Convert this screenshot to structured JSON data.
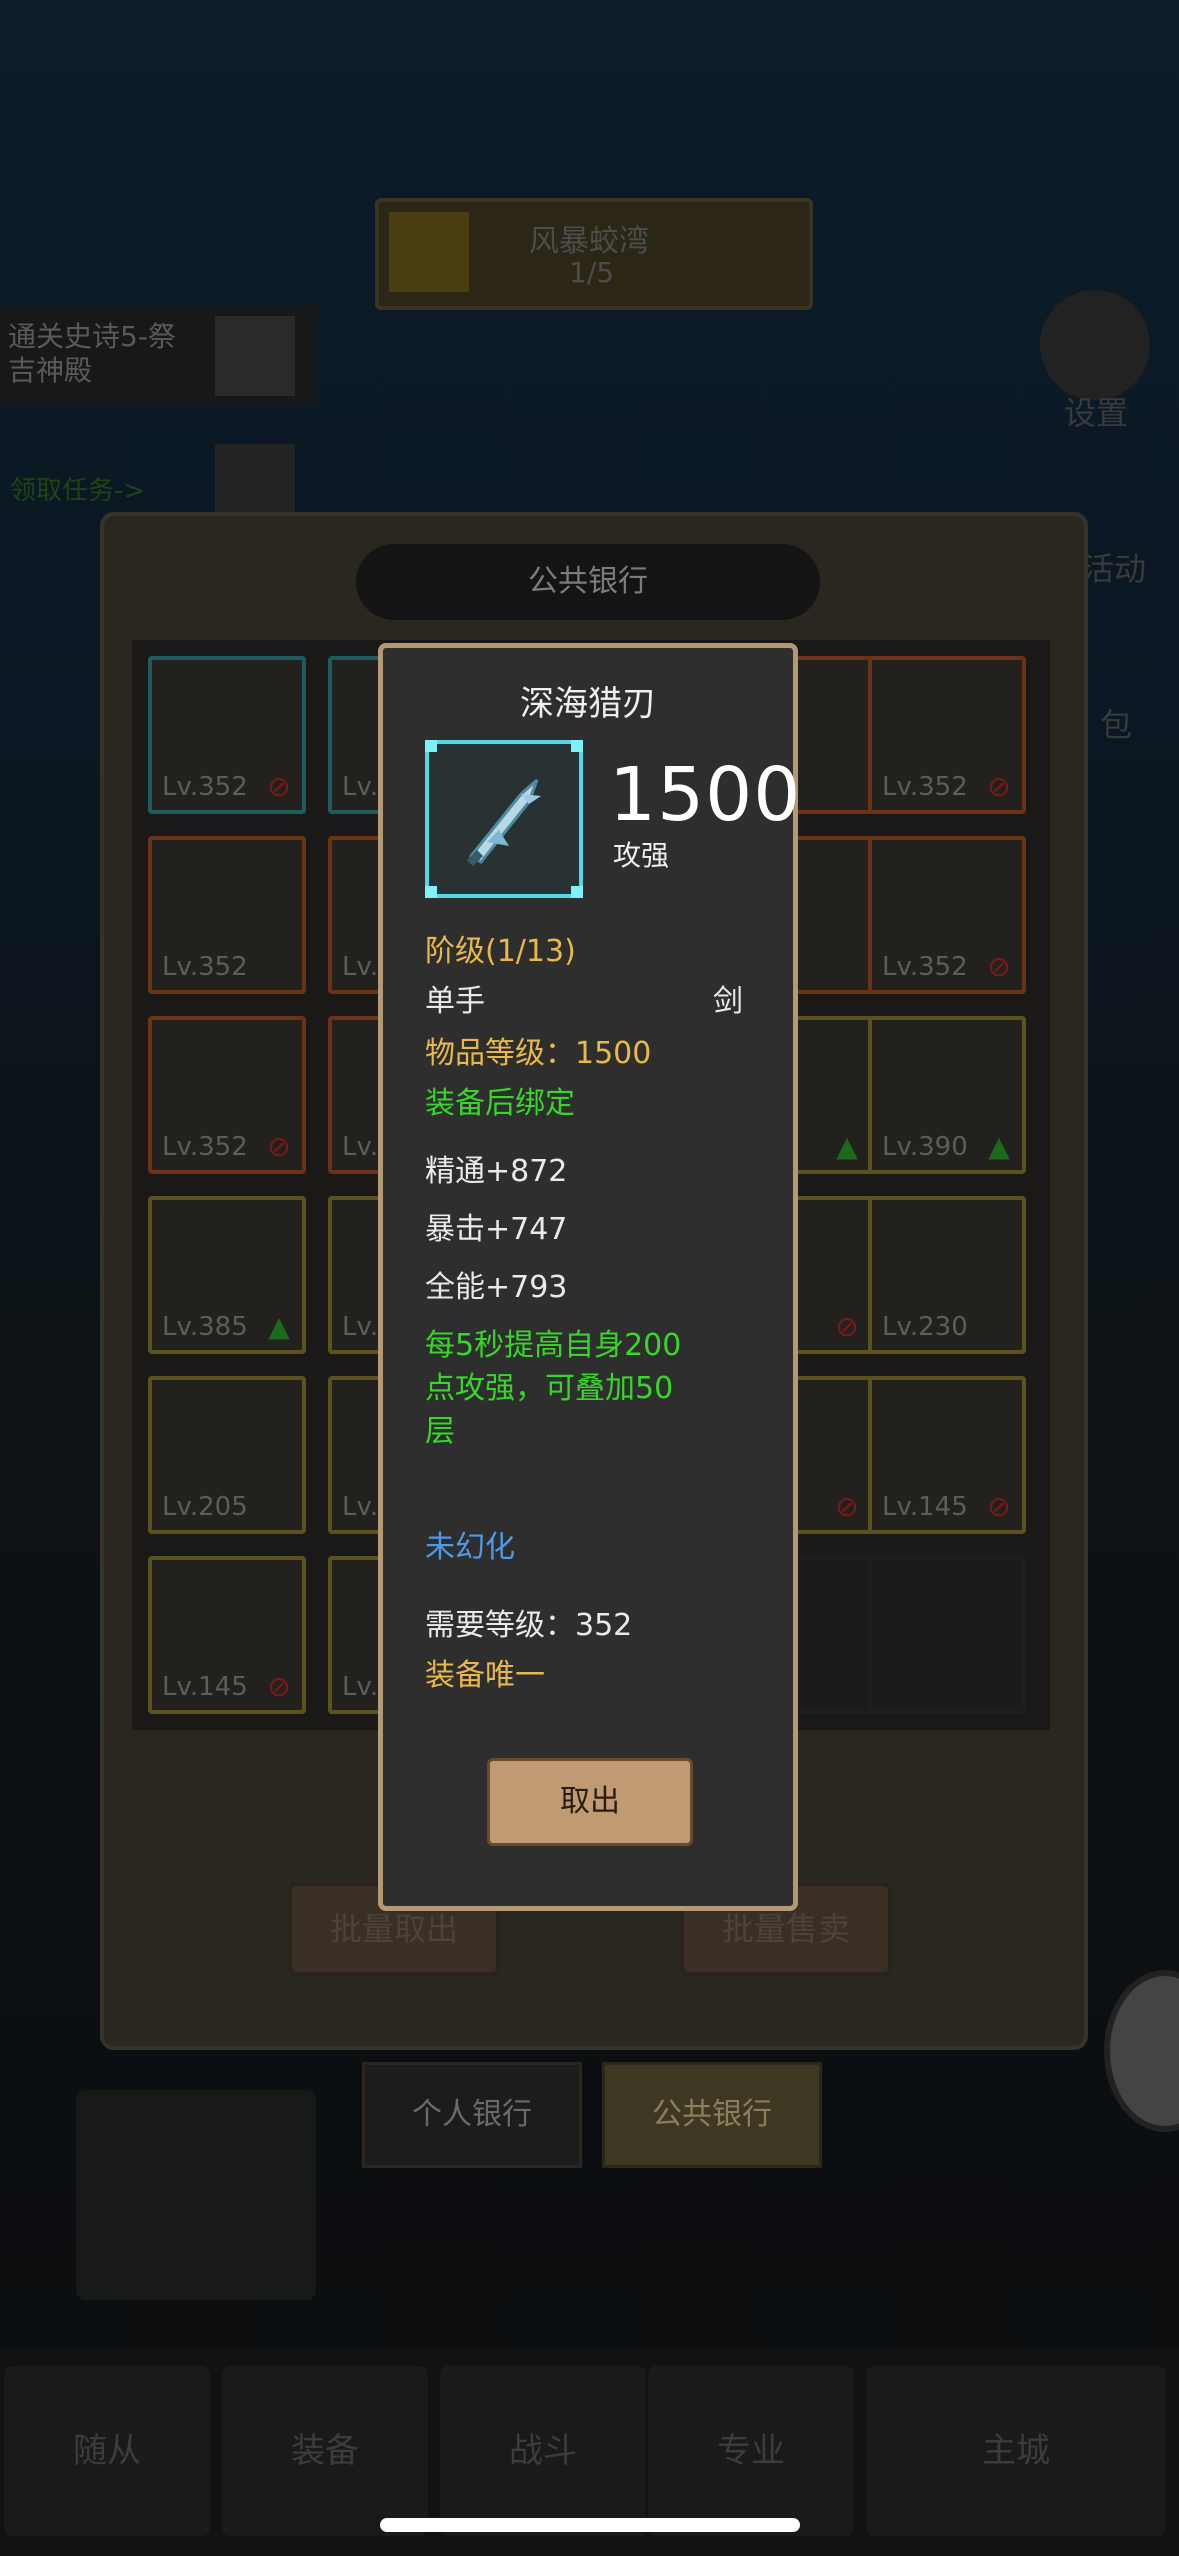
{
  "top_event": {
    "title": "风暴蛟湾",
    "progress": "1/5"
  },
  "quest": {
    "text": "通关史诗5-祭\n吉神殿",
    "task": "领取任务->"
  },
  "side_labels": {
    "settings": "设置",
    "activity": "活动",
    "bag": "包"
  },
  "bank": {
    "title": "公共银行",
    "slots": [
      {
        "lv": "Lv.352",
        "quality": "cyan",
        "mark": "ban"
      },
      {
        "lv": "Lv.",
        "quality": "cyan",
        "mark": ""
      },
      {
        "lv": "",
        "quality": "orange",
        "mark": ""
      },
      {
        "lv": "Lv.352",
        "quality": "orange",
        "mark": "ban"
      },
      {
        "lv": "Lv.352",
        "quality": "orange",
        "mark": ""
      },
      {
        "lv": "Lv.",
        "quality": "orange",
        "mark": ""
      },
      {
        "lv": "",
        "quality": "orange",
        "mark": ""
      },
      {
        "lv": "Lv.352",
        "quality": "orange",
        "mark": "ban"
      },
      {
        "lv": "Lv.352",
        "quality": "orange",
        "mark": "ban"
      },
      {
        "lv": "Lv.",
        "quality": "orange",
        "mark": ""
      },
      {
        "lv": "",
        "quality": "yellow",
        "mark": "up"
      },
      {
        "lv": "Lv.390",
        "quality": "yellow",
        "mark": "up"
      },
      {
        "lv": "Lv.385",
        "quality": "yellow",
        "mark": "up"
      },
      {
        "lv": "Lv.",
        "quality": "yellow",
        "mark": ""
      },
      {
        "lv": "",
        "quality": "yellow",
        "mark": "ban"
      },
      {
        "lv": "Lv.230",
        "quality": "yellow",
        "mark": ""
      },
      {
        "lv": "Lv.205",
        "quality": "yellow",
        "mark": ""
      },
      {
        "lv": "Lv.",
        "quality": "yellow",
        "mark": ""
      },
      {
        "lv": "",
        "quality": "yellow",
        "mark": "ban"
      },
      {
        "lv": "Lv.145",
        "quality": "yellow",
        "mark": "ban"
      },
      {
        "lv": "Lv.145",
        "quality": "yellow",
        "mark": "ban"
      },
      {
        "lv": "Lv.",
        "quality": "yellow",
        "mark": ""
      },
      {
        "lv": "",
        "quality": "empty",
        "mark": ""
      },
      {
        "lv": "",
        "quality": "empty",
        "mark": ""
      }
    ],
    "batch_take": "批量取出",
    "batch_sell": "批量售卖",
    "tabs": {
      "personal": "个人银行",
      "public": "公共银行"
    }
  },
  "bottom_nav": [
    "随从",
    "装备",
    "战斗",
    "专业",
    "主城"
  ],
  "item": {
    "name": "深海猎刃",
    "power": "1500",
    "power_label": "攻强",
    "tier": "阶级(1/13)",
    "hand": "单手",
    "type": "剑",
    "item_level": "物品等级：1500",
    "bind": "装备后绑定",
    "stats": [
      "精通+872",
      "暴击+747",
      "全能+793"
    ],
    "effect": [
      "每5秒提高自身200",
      "点攻强，可叠加50",
      "层"
    ],
    "transmog": "未幻化",
    "req_level": "需要等级：352",
    "unique": "装备唯一",
    "cancel_label": "取出"
  },
  "colors": {
    "cyan": "#58d7e0",
    "gold": "#e8b84a",
    "green": "#37d628",
    "blue": "#4f9ae8"
  }
}
